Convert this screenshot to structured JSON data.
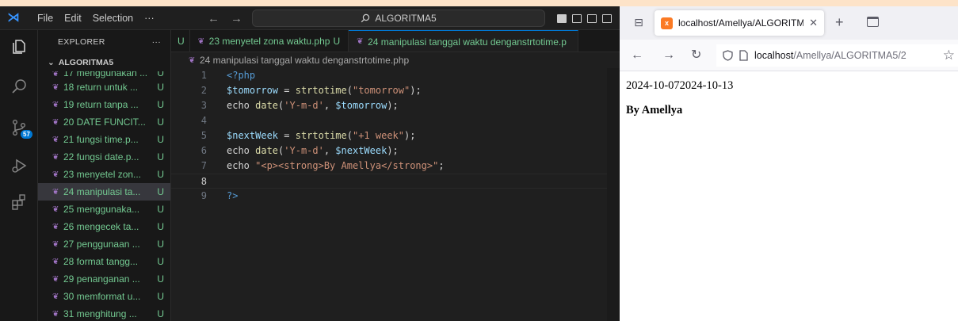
{
  "vscode": {
    "menu": [
      "File",
      "Edit",
      "Selection",
      "···"
    ],
    "search_text": "ALGORITMA5",
    "sidebar": {
      "title": "EXPLORER",
      "more": "···",
      "folder": "ALGORITMA5",
      "files": [
        {
          "name": "17 menggunakan ...",
          "status": "U",
          "cut": true
        },
        {
          "name": "18 return untuk ...",
          "status": "U"
        },
        {
          "name": "19 return tanpa ...",
          "status": "U"
        },
        {
          "name": "20 DATE FUNCIT...",
          "status": "U"
        },
        {
          "name": "21 fungsi time.p...",
          "status": "U"
        },
        {
          "name": "22 fungsi date.p...",
          "status": "U"
        },
        {
          "name": "23 menyetel zon...",
          "status": "U"
        },
        {
          "name": "24 manipulasi ta...",
          "status": "U",
          "selected": true
        },
        {
          "name": "25 menggunaka...",
          "status": "U"
        },
        {
          "name": "26 mengecek ta...",
          "status": "U"
        },
        {
          "name": "27 penggunaan ...",
          "status": "U"
        },
        {
          "name": "28 format tangg...",
          "status": "U"
        },
        {
          "name": "29 penanganan ...",
          "status": "U"
        },
        {
          "name": "30 memformat u...",
          "status": "U"
        },
        {
          "name": "31 menghitung ...",
          "status": "U"
        }
      ]
    },
    "tabs": [
      {
        "name": "",
        "status": "U",
        "partial": true
      },
      {
        "name": "23 menyetel zona waktu.php",
        "status": "U"
      },
      {
        "name": "24 manipulasi tanggal waktu denganstrtotime.p",
        "status": "",
        "active": true
      }
    ],
    "breadcrumb": "24 manipulasi tanggal waktu denganstrtotime.php",
    "source_control_badge": "57",
    "code_lines": [
      {
        "num": "1",
        "tokens": [
          {
            "t": "<?php",
            "c": "tag"
          }
        ]
      },
      {
        "num": "2",
        "tokens": [
          {
            "t": "$tomorrow",
            "c": "var"
          },
          {
            "t": " = ",
            "c": "plain"
          },
          {
            "t": "strtotime",
            "c": "fn"
          },
          {
            "t": "(",
            "c": "plain"
          },
          {
            "t": "\"tomorrow\"",
            "c": "str"
          },
          {
            "t": ");",
            "c": "plain"
          }
        ]
      },
      {
        "num": "3",
        "tokens": [
          {
            "t": "echo ",
            "c": "plain"
          },
          {
            "t": "date",
            "c": "fn"
          },
          {
            "t": "(",
            "c": "plain"
          },
          {
            "t": "'Y-m-d'",
            "c": "str"
          },
          {
            "t": ", ",
            "c": "plain"
          },
          {
            "t": "$tomorrow",
            "c": "var"
          },
          {
            "t": ");",
            "c": "plain"
          }
        ]
      },
      {
        "num": "4",
        "tokens": []
      },
      {
        "num": "5",
        "tokens": [
          {
            "t": "$nextWeek",
            "c": "var"
          },
          {
            "t": " = ",
            "c": "plain"
          },
          {
            "t": "strtotime",
            "c": "fn"
          },
          {
            "t": "(",
            "c": "plain"
          },
          {
            "t": "\"+1 week\"",
            "c": "str"
          },
          {
            "t": ");",
            "c": "plain"
          }
        ]
      },
      {
        "num": "6",
        "tokens": [
          {
            "t": "echo ",
            "c": "plain"
          },
          {
            "t": "date",
            "c": "fn"
          },
          {
            "t": "(",
            "c": "plain"
          },
          {
            "t": "'Y-m-d'",
            "c": "str"
          },
          {
            "t": ", ",
            "c": "plain"
          },
          {
            "t": "$nextWeek",
            "c": "var"
          },
          {
            "t": ");",
            "c": "plain"
          }
        ]
      },
      {
        "num": "7",
        "tokens": [
          {
            "t": "echo ",
            "c": "plain"
          },
          {
            "t": "\"<p><strong>By Amellya</strong>\"",
            "c": "str"
          },
          {
            "t": ";",
            "c": "plain"
          }
        ]
      },
      {
        "num": "8",
        "tokens": [],
        "current": true
      },
      {
        "num": "9",
        "tokens": [
          {
            "t": "?>",
            "c": "tag"
          }
        ]
      }
    ]
  },
  "browser": {
    "tab_title": "localhost/Amellya/ALGORITMA",
    "tab_close": "✕",
    "new_tab": "+",
    "url_host": "localhost",
    "url_path": "/Amellya/ALGORITMA5/2",
    "output_line": "2024-10-072024-10-13",
    "output_author": "By Amellya"
  },
  "colors": {
    "vscode_bg": "#1f1f1f",
    "untracked_green": "#73c991",
    "accent_blue": "#0078d4",
    "desktop_bg": "#fde3c8"
  }
}
